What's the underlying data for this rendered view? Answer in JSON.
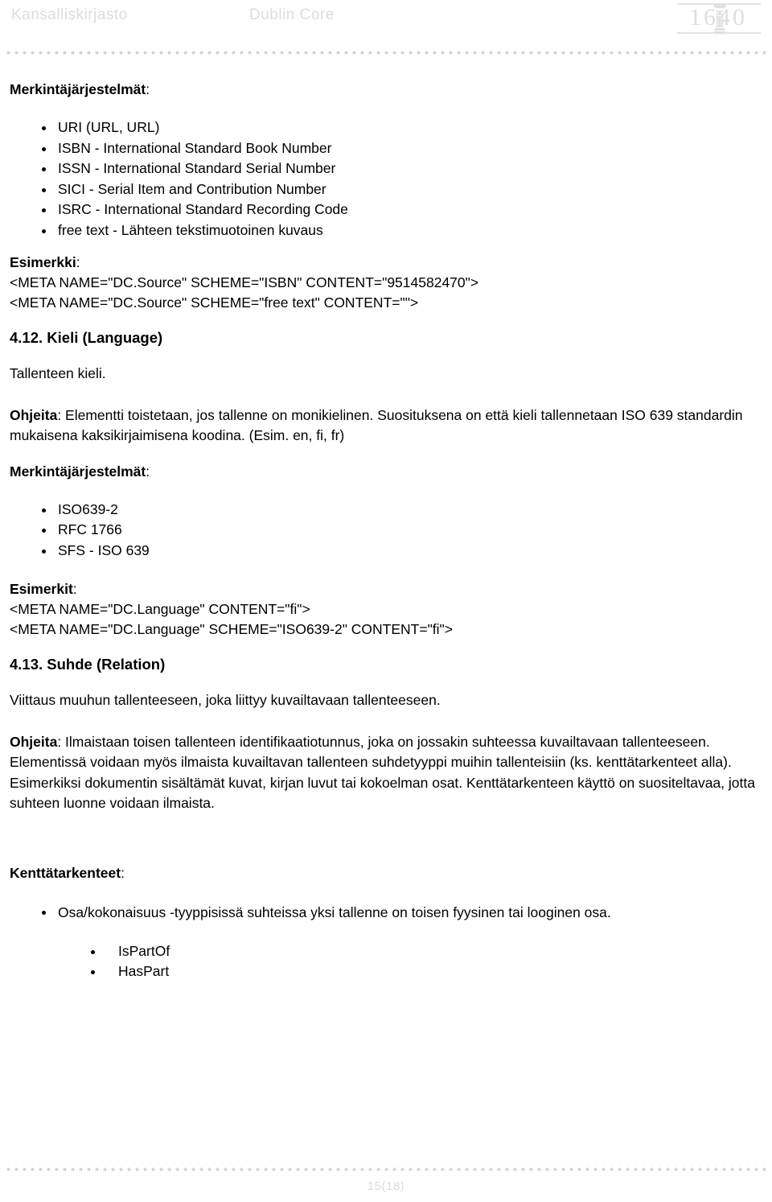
{
  "header": {
    "brand": "Kansalliskirjasto",
    "doc_title": "Dublin Core",
    "logo_year": "1640",
    "logo_icon": "pillar-column-icon"
  },
  "footer": {
    "page_label": "15(18)"
  },
  "content": {
    "source_section": {
      "schemes_heading": "Merkintäjärjestelmät",
      "schemes_heading_colon": ":",
      "schemes": [
        "URI (URL, URL)",
        "ISBN - International Standard Book Number",
        "ISSN - International Standard Serial Number",
        "SICI - Serial Item and Contribution Number",
        "ISRC - International Standard Recording Code",
        "free text - Lähteen tekstimuotoinen kuvaus"
      ],
      "example_heading": "Esimerkki",
      "example_heading_colon": ":",
      "examples": [
        "<META NAME=\"DC.Source\" SCHEME=\"ISBN\" CONTENT=\"9514582470\">",
        "<META NAME=\"DC.Source\" SCHEME=\"free text\" CONTENT=\"\">"
      ]
    },
    "language_section": {
      "number_title": "4.12. Kieli (Language)",
      "definition": "Tallenteen kieli.",
      "guidance_label": "Ohjeita",
      "guidance_text": ": Elementti toistetaan, jos tallenne on monikielinen. Suosituksena on että kieli tallennetaan ISO 639 standardin mukaisena kaksikirjaimisena koodina. (Esim. en, fi, fr)",
      "schemes_heading": "Merkintäjärjestelmät",
      "schemes_heading_colon": ":",
      "schemes": [
        "ISO639-2",
        "RFC 1766",
        "SFS - ISO 639"
      ],
      "example_heading": "Esimerkit",
      "example_heading_colon": ":",
      "examples": [
        "<META NAME=\"DC.Language\" CONTENT=\"fi\">",
        "<META NAME=\"DC.Language\" SCHEME=\"ISO639-2\" CONTENT=\"fi\">"
      ]
    },
    "relation_section": {
      "number_title": "4.13. Suhde (Relation)",
      "definition": "Viittaus muuhun tallenteeseen, joka liittyy kuvailtavaan tallenteeseen.",
      "guidance_label": "Ohjeita",
      "guidance_text": ": Ilmaistaan toisen tallenteen identifikaatiotunnus, joka on jossakin suhteessa kuvailtavaan tallenteeseen. Elementissä voidaan myös ilmaista kuvailtavan tallenteen suhdetyyppi muihin tallenteisiin (ks. kenttätarkenteet alla). Esimerkiksi dokumentin sisältämät kuvat, kirjan luvut tai kokoelman osat. Kenttätarkenteen käyttö on suositeltavaa, jotta suhteen luonne voidaan ilmaista.",
      "qualifiers_heading": "Kenttätarkenteet",
      "qualifiers_heading_colon": ":",
      "qualifier_items": [
        "Osa/kokonaisuus -tyyppisissä suhteissa yksi tallenne on toisen fyysinen tai looginen osa."
      ],
      "qualifier_subitems": [
        "IsPartOf",
        "HasPart"
      ]
    }
  },
  "colors": {
    "header_text": "#dcdcdc",
    "body_text": "#000000",
    "rule_dots": "#d4d4d4",
    "page_background": "#ffffff"
  }
}
